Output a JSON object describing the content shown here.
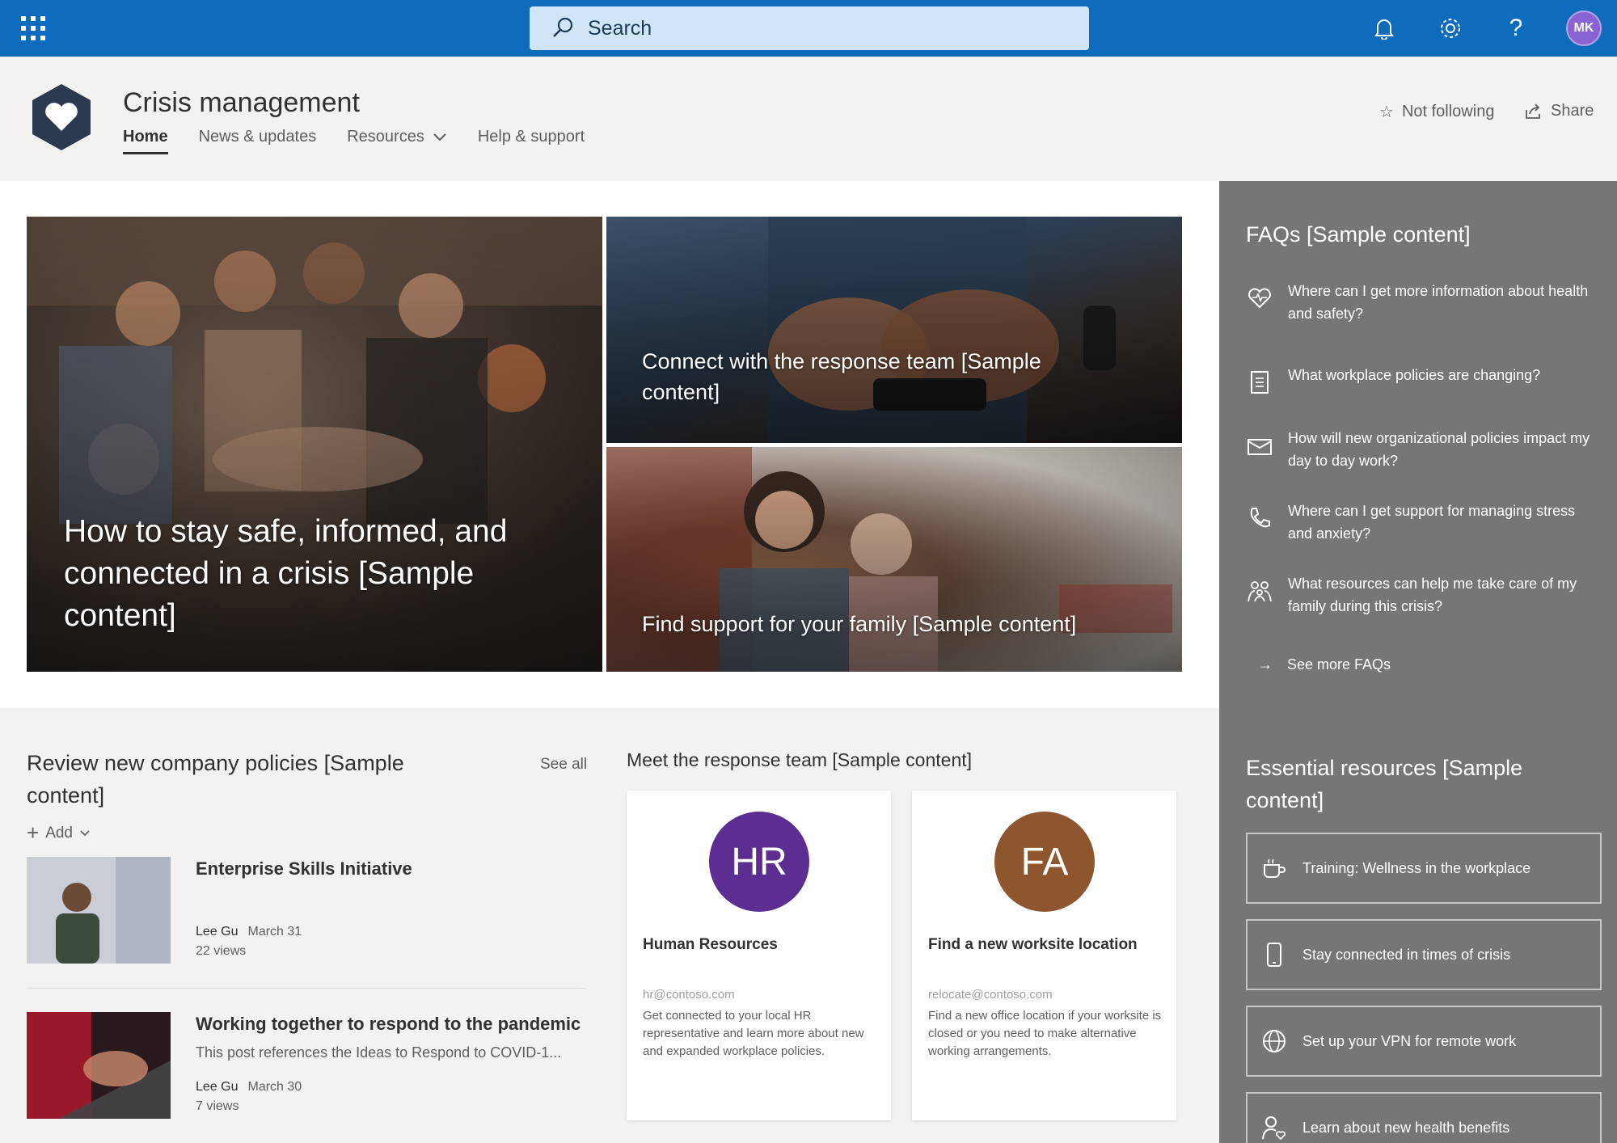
{
  "suitebar": {
    "search_placeholder": "Search",
    "avatar_initials": "MK",
    "accent_color": "#0f6cbd"
  },
  "site": {
    "title": "Crisis management",
    "nav": [
      {
        "label": "Home"
      },
      {
        "label": "News & updates"
      },
      {
        "label": "Resources"
      },
      {
        "label": "Help & support"
      }
    ],
    "not_following": "Not following",
    "share": "Share"
  },
  "hero": {
    "tile1": "How to stay safe, informed, and connected in a crisis [Sample content]",
    "tile2": "Connect with the response team [Sample content]",
    "tile3": "Find support for your family [Sample content]"
  },
  "news": {
    "title": "Review new company policies [Sample content]",
    "see_all": "See all",
    "add": "Add",
    "items": [
      {
        "title": "Enterprise Skills Initiative",
        "desc": "",
        "author": "Lee Gu",
        "date": "March 31",
        "views": "22 views"
      },
      {
        "title": "Working together to respond to the pandemic",
        "desc": "This post references the Ideas to Respond to COVID-1...",
        "author": "Lee Gu",
        "date": "March 30",
        "views": "7 views"
      }
    ]
  },
  "people": {
    "title": "Meet the response team [Sample content]",
    "cards": [
      {
        "initials": "HR",
        "name": "Human Resources",
        "email": "hr@contoso.com",
        "desc": "Get connected to your local HR representative and learn more about new and expanded workplace policies.",
        "color": "#5c2e91"
      },
      {
        "initials": "FA",
        "name": "Find a new worksite location",
        "email": "relocate@contoso.com",
        "desc": "Find a new office location if your worksite is closed or you need to make alternative working arrangements.",
        "color": "#8e562e"
      }
    ]
  },
  "faqs": {
    "title": "FAQs [Sample content]",
    "items": [
      {
        "text": "Where can I get more information about health and safety?",
        "icon": "health-heart-icon"
      },
      {
        "text": "What workplace policies are changing?",
        "icon": "document-icon"
      },
      {
        "text": "How will new organizational policies impact my day to day work?",
        "icon": "mail-icon"
      },
      {
        "text": "Where can I get support for managing stress and anxiety?",
        "icon": "phone-icon"
      },
      {
        "text": "What resources can help me take care of my family during this crisis?",
        "icon": "family-icon"
      }
    ],
    "see_more": "See more FAQs"
  },
  "resources": {
    "title": "Essential resources [Sample content]",
    "items": [
      {
        "label": "Training: Wellness in the workplace",
        "icon": "coffee-icon"
      },
      {
        "label": "Stay connected in times of crisis",
        "icon": "mobile-icon"
      },
      {
        "label": "Set up your VPN for remote work",
        "icon": "globe-icon"
      },
      {
        "label": "Learn about new health benefits",
        "icon": "person-health-icon"
      }
    ]
  }
}
